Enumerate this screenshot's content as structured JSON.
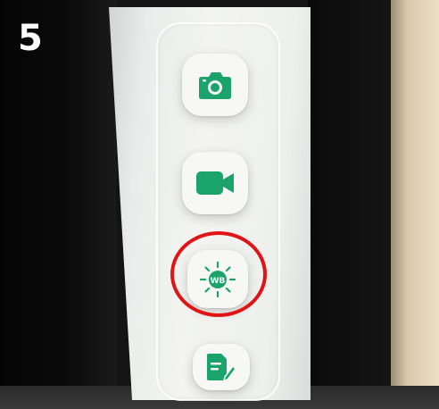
{
  "step_number": "5",
  "toolbar": {
    "buttons": [
      {
        "id": "camera",
        "icon": "camera-icon",
        "label": ""
      },
      {
        "id": "video",
        "icon": "video-camera-icon",
        "label": ""
      },
      {
        "id": "whiteboard",
        "icon": "whiteboard-sun-icon",
        "label": "WB"
      },
      {
        "id": "notes",
        "icon": "document-edit-icon",
        "label": ""
      }
    ],
    "highlighted_button": "whiteboard"
  },
  "colors": {
    "accent_green": "#1aa36b",
    "highlight_red": "#e01414",
    "panel_background": "#eef0ee",
    "step_number_color": "#ffffff"
  }
}
